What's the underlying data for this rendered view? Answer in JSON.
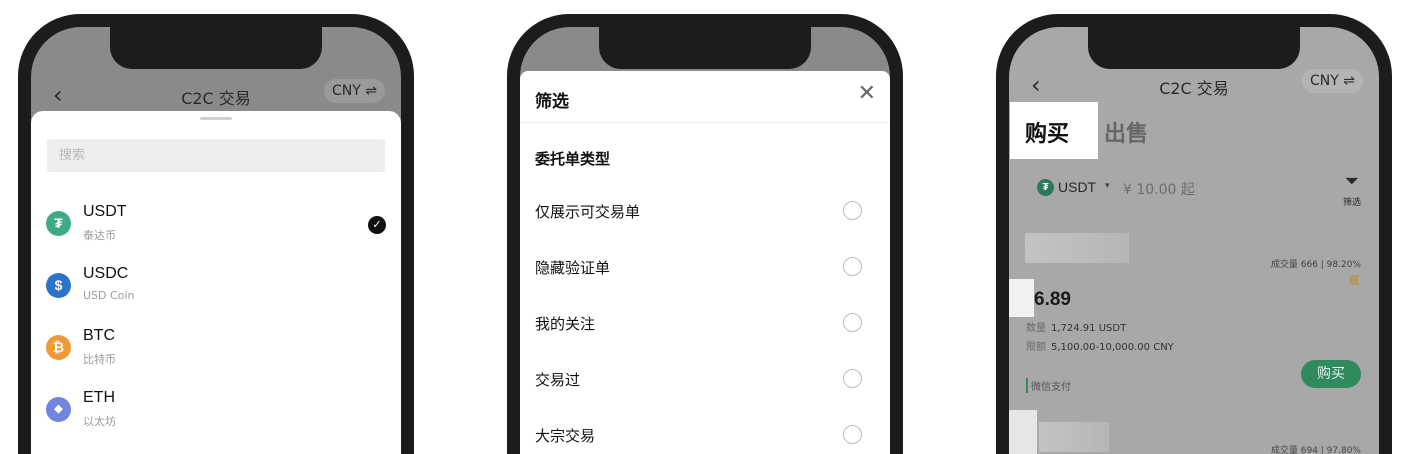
{
  "nav": {
    "back": "‹",
    "title": "C2C 交易",
    "currency": "CNY ⇌"
  },
  "coin_picker": {
    "search_placeholder": "搜索",
    "coins": [
      {
        "symbol": "USDT",
        "name": "泰达币",
        "icon": "tether-icon",
        "glyph": "₮",
        "color": "#3eaa87",
        "selected": true
      },
      {
        "symbol": "USDC",
        "name": "USD Coin",
        "icon": "usdc-icon",
        "glyph": "$",
        "color": "#2d72cc",
        "selected": false
      },
      {
        "symbol": "BTC",
        "name": "比特币",
        "icon": "bitcoin-icon",
        "glyph": "₿",
        "color": "#ef9a36",
        "selected": false
      },
      {
        "symbol": "ETH",
        "name": "以太坊",
        "icon": "ethereum-icon",
        "glyph": "◆",
        "color": "#6f85e0",
        "selected": false
      }
    ]
  },
  "filter": {
    "title": "筛选",
    "close": "✕",
    "section": "委托单类型",
    "options": [
      {
        "label": "仅展示可交易单"
      },
      {
        "label": "隐藏验证单"
      },
      {
        "label": "我的关注"
      },
      {
        "label": "交易过"
      },
      {
        "label": "大宗交易"
      }
    ]
  },
  "market": {
    "tabs": {
      "buy": "购买",
      "sell": "出售"
    },
    "coin": "USDT",
    "coin_caret": "▾",
    "amount_placeholder": "¥ 10.00 起",
    "filter_icon": "⏷",
    "filter_label": "筛选",
    "ads": [
      {
        "stats": "成交量 666 | 98.20%",
        "price": "6.89",
        "quantity_label": "数量",
        "quantity": "1,724.91 USDT",
        "limit_label": "限额",
        "limit": "5,100.00-10,000.00 CNY",
        "payment": "微信支付",
        "button": "购买"
      },
      {
        "stats": "成交量 694 | 97.80%"
      }
    ]
  },
  "colors": {
    "accent_green": "#2f8a5c",
    "tether": "#3eaa87"
  }
}
